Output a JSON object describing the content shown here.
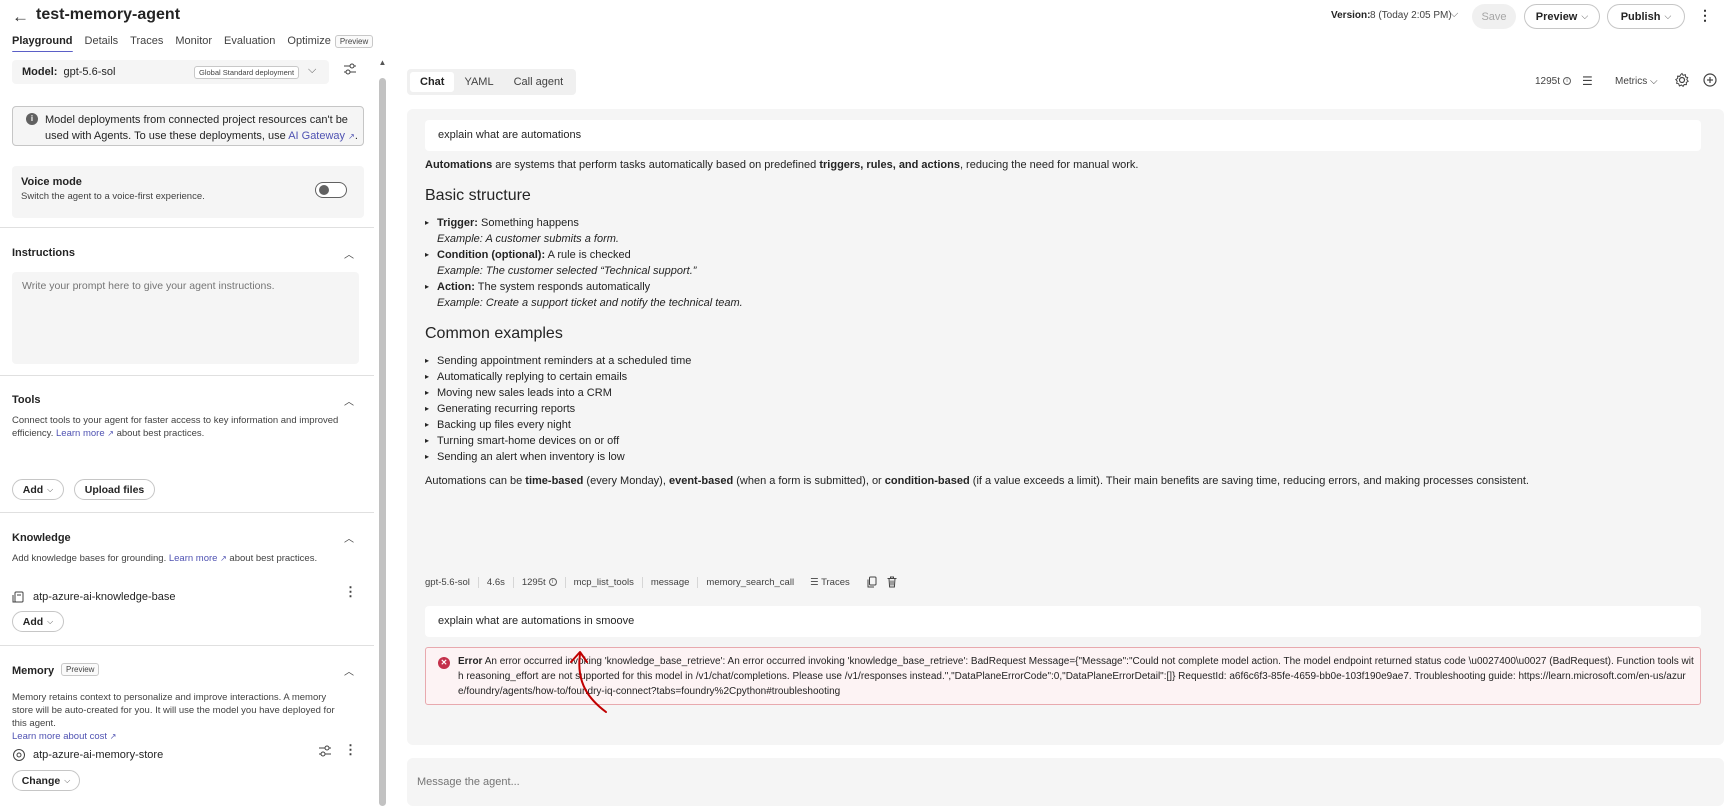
{
  "header": {
    "back_icon": "arrow-left-icon",
    "title": "test-memory-agent",
    "tabs": [
      {
        "label": "Playground",
        "active": true
      },
      {
        "label": "Details",
        "active": false
      },
      {
        "label": "Traces",
        "active": false
      },
      {
        "label": "Monitor",
        "active": false
      },
      {
        "label": "Evaluation",
        "active": false
      },
      {
        "label": "Optimize",
        "active": false
      }
    ],
    "optimize_badge": "Preview",
    "version_label": "Version:",
    "version_value": "8 (Today 2:05 PM)",
    "save_label": "Save",
    "preview_label": "Preview",
    "publish_label": "Publish"
  },
  "left": {
    "model_label": "Model:",
    "model_value": "gpt-5.6-sol",
    "deployment_badge": "Global Standard deployment",
    "info": {
      "text": "Model deployments from connected project resources can't be used with Agents. To use these deployments, use ",
      "link": "AI Gateway",
      "suffix": "."
    },
    "voice": {
      "title": "Voice mode",
      "description": "Switch the agent to a voice-first experience.",
      "enabled": false
    },
    "instructions": {
      "title": "Instructions",
      "placeholder": "Write your prompt here to give your agent instructions."
    },
    "tools": {
      "title": "Tools",
      "desc_before": "Connect tools to your agent for faster access to key information and improved efficiency. ",
      "learn_more": "Learn more",
      "desc_after": " about best practices.",
      "add_label": "Add",
      "upload_label": "Upload files"
    },
    "knowledge": {
      "title": "Knowledge",
      "desc_before": "Add knowledge bases for grounding. ",
      "learn_more": "Learn more",
      "desc_after": " about best practices.",
      "item": "atp-azure-ai-knowledge-base",
      "add_label": "Add"
    },
    "memory": {
      "title": "Memory",
      "badge": "Preview",
      "desc": "Memory retains context to personalize and improve interactions. A memory store will be auto-created for you. It will use the model you have deployed for this agent.",
      "learn_more": "Learn more about cost",
      "item": "atp-azure-ai-memory-store",
      "change_label": "Change"
    }
  },
  "right": {
    "tabs": [
      {
        "label": "Chat",
        "active": true
      },
      {
        "label": "YAML",
        "active": false
      },
      {
        "label": "Call agent",
        "active": false
      }
    ],
    "tokens": "1295t",
    "metrics_label": "Metrics",
    "chat": {
      "user_message_1": "explain what are automations",
      "answer": {
        "intro_b1": "Automations",
        "intro_t1": " are systems that perform tasks automatically based on predefined ",
        "intro_b2": "triggers, rules, and actions",
        "intro_t2": ", reducing the need for manual work.",
        "heading_1": "Basic structure",
        "structure": [
          {
            "label": "Trigger:",
            "text": " Something happens",
            "example": "Example: A customer submits a form."
          },
          {
            "label": "Condition (optional):",
            "text": " A rule is checked",
            "example": "Example: The customer selected “Technical support.”"
          },
          {
            "label": "Action:",
            "text": " The system responds automatically",
            "example": "Example: Create a support ticket and notify the technical team."
          }
        ],
        "heading_2": "Common examples",
        "examples": [
          "Sending appointment reminders at a scheduled time",
          "Automatically replying to certain emails",
          "Moving new sales leads into a CRM",
          "Generating recurring reports",
          "Backing up files every night",
          "Turning smart-home devices on or off",
          "Sending an alert when inventory is low"
        ],
        "closing_t1": "Automations can be ",
        "closing_b1": "time-based",
        "closing_t2": " (every Monday), ",
        "closing_b2": "event-based",
        "closing_t3": " (when a form is submitted), or ",
        "closing_b3": "condition-based",
        "closing_t4": " (if a value exceeds a limit). Their main benefits are saving time, reducing errors, and making processes consistent."
      },
      "meta": {
        "model": "gpt-5.6-sol",
        "duration": "4.6s",
        "tokens": "1295t",
        "tool_1": "mcp_list_tools",
        "tool_2": "message",
        "tool_3": "memory_search_call",
        "traces_label": "Traces"
      },
      "user_message_2": "explain what are automations in smoove",
      "error": {
        "label": "Error",
        "message": "An error occurred invoking 'knowledge_base_retrieve': An error occurred invoking 'knowledge_base_retrieve': BadRequest Message={\"Message\":\"Could not complete model action. The model endpoint returned status code \\u0027400\\u0027 (BadRequest). Function tools with reasoning_effort are not supported for this model in /v1/chat/completions. Please use /v1/responses instead.\",\"DataPlaneErrorCode\":0,\"DataPlaneErrorDetail\":[]} RequestId: a6f6c6f3-85fe-4659-bb0e-103f190e9ae7. Troubleshooting guide: https://learn.microsoft.com/en-us/azure/foundry/agents/how-to/foundry-iq-connect?tabs=foundry%2Cpython#troubleshooting"
      }
    },
    "input_placeholder": "Message the agent..."
  },
  "colors": {
    "accent": "#5b5fc7",
    "link": "#4f52b2",
    "error_border": "#e8a9ae",
    "error_bg": "#fdf3f4",
    "annotation": "#c00000"
  }
}
